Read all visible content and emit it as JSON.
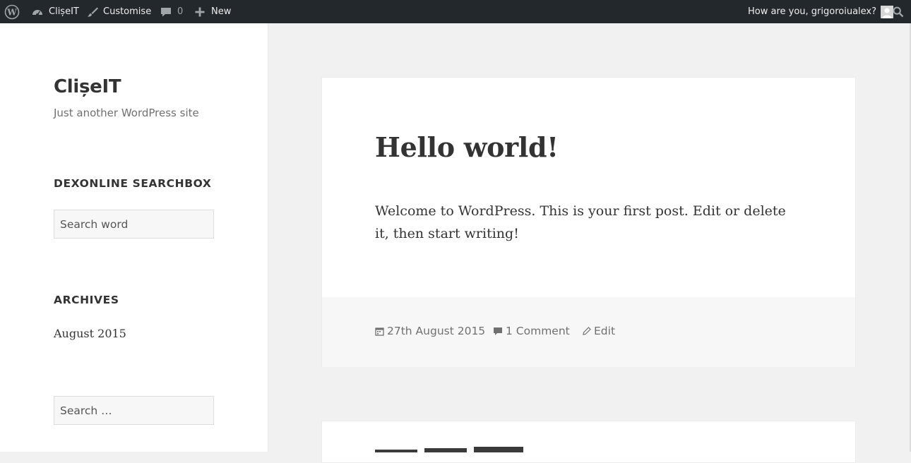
{
  "adminbar": {
    "site_name": "ClișeIT",
    "customise_label": "Customise",
    "comments_count": "0",
    "new_label": "New",
    "greeting": "How are you, grigoroiualex?"
  },
  "sidebar": {
    "site_title": "ClișeIT",
    "site_description": "Just another WordPress site",
    "dexonline_widget_title": "DEXONLINE SEARCHBOX",
    "dexonline_placeholder": "Search word",
    "archives_title": "ARCHIVES",
    "archives": [
      {
        "label": "August 2015"
      }
    ],
    "search_placeholder": "Search …"
  },
  "post": {
    "title": "Hello world!",
    "body": "Welcome to WordPress. This is your first post. Edit or delete it, then start writing!",
    "date": "27th August 2015",
    "comments": "1 Comment",
    "edit": "Edit"
  },
  "colors": {
    "adminbar_bg": "#23282d",
    "page_bg": "#f1f1f1",
    "text": "#333333",
    "meta": "#707070"
  }
}
